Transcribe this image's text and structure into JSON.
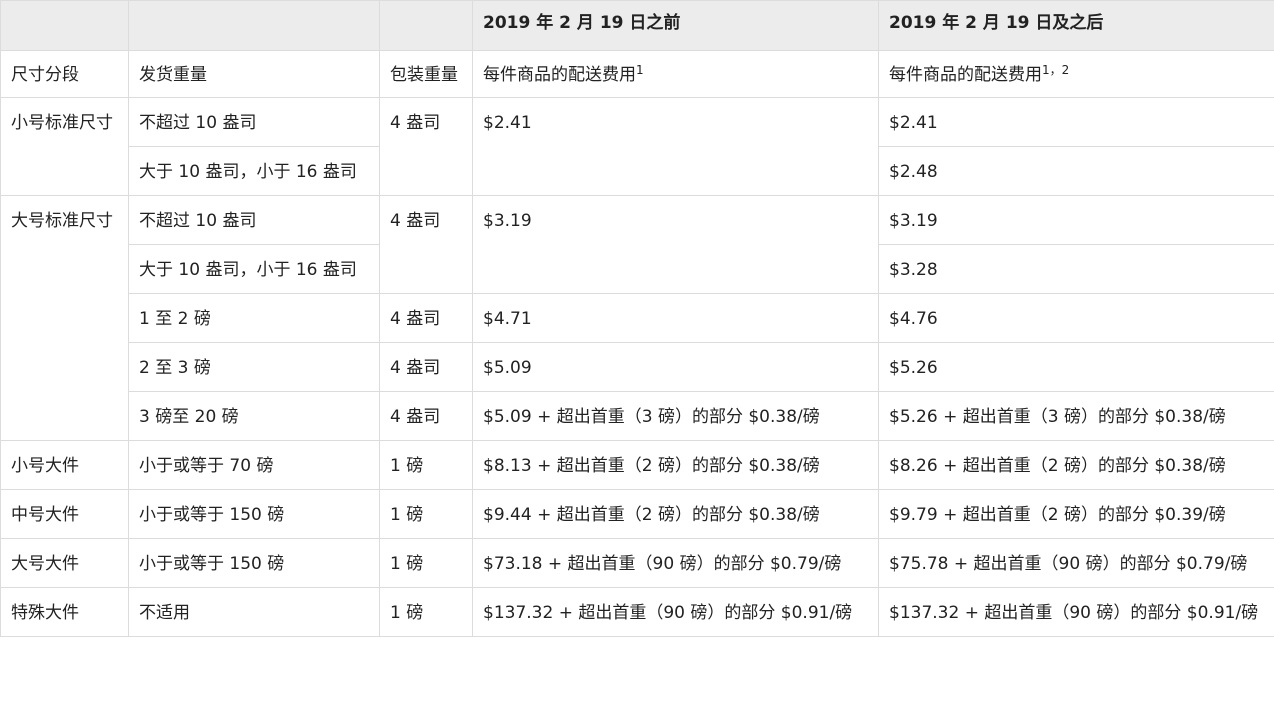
{
  "header": {
    "col1": "",
    "col2": "",
    "col3": "",
    "col4": "2019 年 2 月 19 日之前",
    "col5": "2019 年 2 月 19 日及之后"
  },
  "subheader": {
    "size_tier": "尺寸分段",
    "shipping_weight": "发货重量",
    "packaging_weight": "包装重量",
    "fee_before": "每件商品的配送费用",
    "fee_before_sup": "1",
    "fee_after": "每件商品的配送费用",
    "fee_after_sup": "1，2"
  },
  "rows": {
    "small_standard": {
      "tier": "小号标准尺寸",
      "r1_weight": "不超过 10 盎司",
      "r2_weight": "大于 10 盎司，小于 16 盎司",
      "packaging": "4 盎司",
      "fee_before": "$2.41",
      "r1_fee_after": "$2.41",
      "r2_fee_after": "$2.48"
    },
    "large_standard": {
      "tier": "大号标准尺寸",
      "r1_weight": "不超过 10 盎司",
      "r2_weight": "大于 10 盎司，小于 16 盎司",
      "r12_packaging": "4 盎司",
      "r12_fee_before": "$3.19",
      "r1_fee_after": "$3.19",
      "r2_fee_after": "$3.28",
      "r3_weight": "1 至 2 磅",
      "r3_packaging": "4 盎司",
      "r3_fee_before": "$4.71",
      "r3_fee_after": "$4.76",
      "r4_weight": "2 至 3 磅",
      "r4_packaging": "4 盎司",
      "r4_fee_before": "$5.09",
      "r4_fee_after": "$5.26",
      "r5_weight": "3 磅至 20 磅",
      "r5_packaging": "4 盎司",
      "r5_fee_before": "$5.09 + 超出首重（3 磅）的部分 $0.38/磅",
      "r5_fee_after": "$5.26 + 超出首重（3 磅）的部分 $0.38/磅"
    },
    "small_oversize": {
      "tier": "小号大件",
      "weight": "小于或等于 70 磅",
      "packaging": "1 磅",
      "fee_before": "$8.13 + 超出首重（2 磅）的部分 $0.38/磅",
      "fee_after": "$8.26 + 超出首重（2 磅）的部分 $0.38/磅"
    },
    "medium_oversize": {
      "tier": "中号大件",
      "weight": "小于或等于 150 磅",
      "packaging": "1 磅",
      "fee_before": "$9.44 + 超出首重（2 磅）的部分 $0.38/磅",
      "fee_after": "$9.79 + 超出首重（2 磅）的部分 $0.39/磅"
    },
    "large_oversize": {
      "tier": "大号大件",
      "weight": "小于或等于 150 磅",
      "packaging": "1 磅",
      "fee_before": "$73.18 + 超出首重（90 磅）的部分 $0.79/磅",
      "fee_after": "$75.78 + 超出首重（90 磅）的部分 $0.79/磅"
    },
    "special_oversize": {
      "tier": "特殊大件",
      "weight": "不适用",
      "packaging": "1 磅",
      "fee_before": "$137.32 + 超出首重（90 磅）的部分 $0.91/磅",
      "fee_after": "$137.32 + 超出首重（90 磅）的部分 $0.91/磅"
    }
  }
}
